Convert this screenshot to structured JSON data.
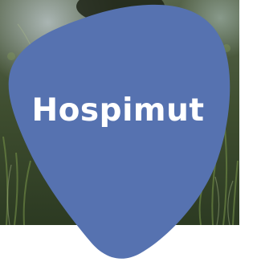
{
  "brand": {
    "name": "Hospimut",
    "blob_color": "#5672b0",
    "text_color": "#ffffff"
  },
  "hero": {
    "image_icon": "grass-foliage-photo"
  }
}
